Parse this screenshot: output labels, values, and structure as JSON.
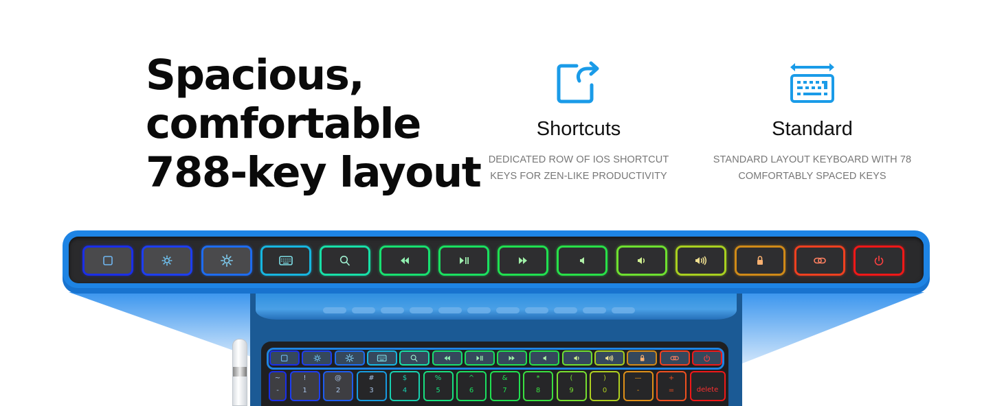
{
  "headline": {
    "lines": [
      "Spacious,",
      "comfortable",
      "788-key layout"
    ]
  },
  "features": [
    {
      "icon": "share-shortcut-icon",
      "title": "Shortcuts",
      "description_lines": [
        "DEDICATED ROW OF IOS SHORTCUT",
        "KEYS FOR ZEN-LIKE PRODUCTIVITY"
      ]
    },
    {
      "icon": "keyboard-width-icon",
      "title": "Standard",
      "description_lines": [
        "STANDARD LAYOUT KEYBOARD WITH 78",
        "COMFORTABLY SPACED KEYS"
      ]
    }
  ],
  "colors": {
    "accent_blue": "#1e84e4",
    "icon_blue": "#1a9be8",
    "headline": "#0a0a0a",
    "description": "#777777"
  },
  "shortcut_row": [
    {
      "name": "home",
      "icon": "home-square-icon",
      "glow": "#1a2ee8",
      "glyph": "#6fb6f0"
    },
    {
      "name": "brightness-down",
      "icon": "brightness-low-icon",
      "glow": "#1d3ef0",
      "glyph": "#6fc2f0"
    },
    {
      "name": "brightness-up",
      "icon": "brightness-high-icon",
      "glow": "#1e6cf0",
      "glyph": "#80d0f4"
    },
    {
      "name": "keyboard",
      "icon": "keyboard-icon",
      "glow": "#17b6e0",
      "glyph": "#7fe0e8"
    },
    {
      "name": "search",
      "icon": "search-icon",
      "glow": "#18e0a8",
      "glyph": "#9ff0d0"
    },
    {
      "name": "previous-track",
      "icon": "rewind-icon",
      "glow": "#18e070",
      "glyph": "#90f0b0"
    },
    {
      "name": "play-pause",
      "icon": "play-pause-icon",
      "glow": "#1ae060",
      "glyph": "#a0f0b0"
    },
    {
      "name": "next-track",
      "icon": "fast-forward-icon",
      "glow": "#20e050",
      "glyph": "#a0f0a8"
    },
    {
      "name": "mute",
      "icon": "speaker-mute-icon",
      "glow": "#28e048",
      "glyph": "#b0f0a8"
    },
    {
      "name": "volume-down",
      "icon": "volume-low-icon",
      "glow": "#6ee030",
      "glyph": "#d0f090"
    },
    {
      "name": "volume-up",
      "icon": "volume-high-icon",
      "glow": "#a8d020",
      "glyph": "#f0e090"
    },
    {
      "name": "lock",
      "icon": "lock-icon",
      "glow": "#d08a18",
      "glyph": "#f8b070"
    },
    {
      "name": "link",
      "icon": "link-icon",
      "glow": "#f04020",
      "glyph": "#ff8060"
    },
    {
      "name": "power",
      "icon": "power-icon",
      "glow": "#f01818",
      "glyph": "#ff4040"
    }
  ],
  "number_row": [
    {
      "top": "~",
      "bottom": "-",
      "glow": "#1a2ee8"
    },
    {
      "top": "!",
      "bottom": "1",
      "glow": "#1d3ef0"
    },
    {
      "top": "@",
      "bottom": "2",
      "glow": "#1e5cf0"
    },
    {
      "top": "#",
      "bottom": "3",
      "glow": "#179ce0"
    },
    {
      "top": "$",
      "bottom": "4",
      "glow": "#18d0b0"
    },
    {
      "top": "%",
      "bottom": "5",
      "glow": "#18e080"
    },
    {
      "top": "^",
      "bottom": "6",
      "glow": "#1ae060"
    },
    {
      "top": "&",
      "bottom": "7",
      "glow": "#20e050"
    },
    {
      "top": "*",
      "bottom": "8",
      "glow": "#3ae040"
    },
    {
      "top": "(",
      "bottom": "9",
      "glow": "#78e030"
    },
    {
      "top": ")",
      "bottom": "0",
      "glow": "#b0d020"
    },
    {
      "top": "—",
      "bottom": "-",
      "glow": "#e09018"
    },
    {
      "top": "+",
      "bottom": "=",
      "glow": "#f05020"
    },
    {
      "top": "",
      "bottom": "delete",
      "glow": "#f01818"
    }
  ]
}
